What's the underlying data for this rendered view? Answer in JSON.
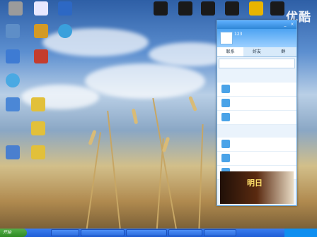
{
  "desktop": {
    "icons": [
      {
        "label": "",
        "color": "#9b9b9b"
      },
      {
        "label": "",
        "color": "#e8e8ff"
      },
      {
        "label": "",
        "color": "#2d68c4"
      },
      {
        "label": "",
        "color": "#1a1a1a"
      },
      {
        "label": "",
        "color": "#1a1a1a"
      },
      {
        "label": "",
        "color": "#1a1a1a"
      },
      {
        "label": "",
        "color": "#1a1a1a"
      },
      {
        "label": "",
        "color": "#e8b400"
      },
      {
        "label": "",
        "color": "#1a1a1a"
      }
    ],
    "left_icons": [
      {
        "label": "",
        "color": "#5e8ec7"
      },
      {
        "label": "",
        "color": "#d49a24"
      },
      {
        "label": "",
        "color": "#3aa0dc"
      },
      {
        "label": "",
        "color": "#3e7bd3"
      },
      {
        "label": "",
        "color": "#c43d2e"
      },
      {
        "label": "",
        "color": "#4aa9e3"
      },
      {
        "label": "",
        "color": "#4b87d6"
      },
      {
        "label": "",
        "color": "#e2c03a"
      },
      {
        "label": "",
        "color": "#e2c03a"
      },
      {
        "label": "",
        "color": "#e2c03a"
      },
      {
        "label": "",
        "color": "#4a7fcf"
      }
    ]
  },
  "watermark": "优酷",
  "qq": {
    "title": "",
    "nickname": "123",
    "status_message": "",
    "tabs": [
      "联系",
      "好友",
      "群"
    ],
    "search_placeholder": "",
    "groups": [
      "",
      "",
      "",
      ""
    ],
    "contacts": [
      {
        "name": "",
        "status": "",
        "extra": ""
      },
      {
        "name": "",
        "status": "",
        "extra": ""
      },
      {
        "name": "",
        "status": "",
        "extra": ""
      },
      {
        "name": "",
        "status": "",
        "extra": ""
      },
      {
        "name": "",
        "status": "",
        "extra": ""
      },
      {
        "name": "",
        "status": "",
        "extra": ""
      }
    ],
    "ad_text": "明日"
  },
  "taskbar": {
    "start_label": "开始",
    "tasks": [
      "",
      "",
      "",
      "",
      ""
    ],
    "clock": ""
  }
}
